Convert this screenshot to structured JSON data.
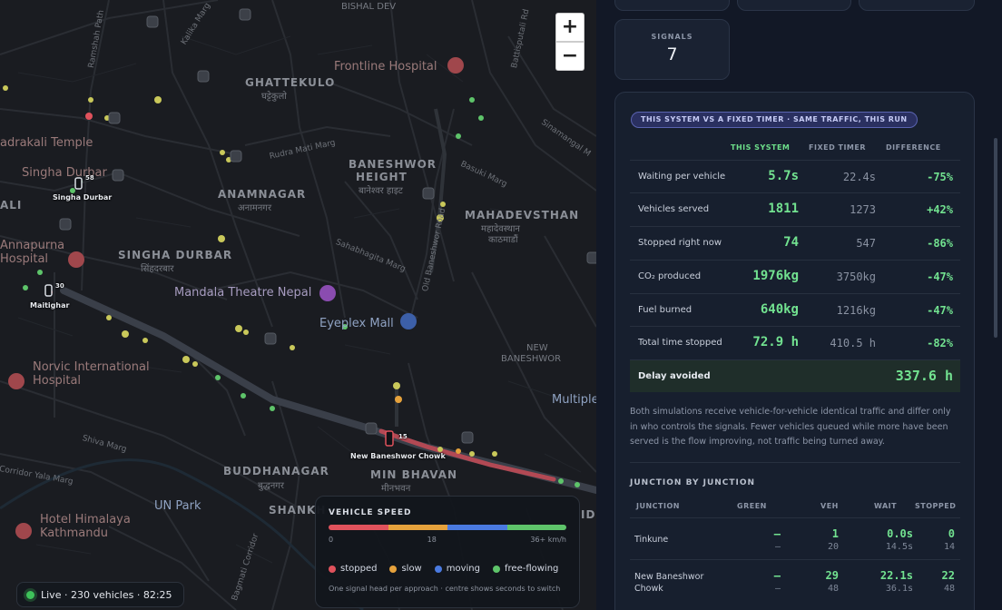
{
  "map": {
    "zoom_in": "+",
    "zoom_out": "−",
    "places": [
      {
        "id": "bishal-dev",
        "text": "BISHAL DEV"
      },
      {
        "id": "ghattekulo",
        "text": "GHATTEKULO"
      },
      {
        "id": "ghattekulo-np",
        "text": "घट्टेकुलो"
      },
      {
        "id": "frontline-hospital",
        "text": "Frontline Hospital"
      },
      {
        "id": "kadrakali-temple",
        "text": "adrakali Temple"
      },
      {
        "id": "singha-durbar-top",
        "text": "Singha Durbar"
      },
      {
        "id": "baneshwor-height",
        "text": "BANESHWOR"
      },
      {
        "id": "baneshwor-height-2",
        "text": "HEIGHT"
      },
      {
        "id": "baneshwor-height-np",
        "text": "बानेश्वर हाइट"
      },
      {
        "id": "anamnagar",
        "text": "ANAMNAGAR"
      },
      {
        "id": "anamnagar-np",
        "text": "अनामनगर"
      },
      {
        "id": "mahadevsthan",
        "text": "MAHADEVSTHAN"
      },
      {
        "id": "mahadevsthan-np",
        "text": "महादेवस्थान"
      },
      {
        "id": "mahadevsthan-np2",
        "text": "काठमाडौं"
      },
      {
        "id": "ali",
        "text": "ALI"
      },
      {
        "id": "annapurna",
        "text": "Annapurna"
      },
      {
        "id": "hospital-left",
        "text": "Hospital"
      },
      {
        "id": "singha-durbar",
        "text": "SINGHA DURBAR"
      },
      {
        "id": "singha-durbar-np",
        "text": "सिंहदरबार"
      },
      {
        "id": "mandala-theatre",
        "text": "Mandala Theatre Nepal"
      },
      {
        "id": "eyeplex-mall",
        "text": "Eyeplex Mall"
      },
      {
        "id": "norvic",
        "text": "Norvic International"
      },
      {
        "id": "norvic-2",
        "text": "Hospital"
      },
      {
        "id": "new-baneshwor",
        "text": "NEW"
      },
      {
        "id": "new-baneshwor-2",
        "text": "BANESHWOR"
      },
      {
        "id": "multiple",
        "text": "Multiple"
      },
      {
        "id": "buddhanagar",
        "text": "BUDDHANAGAR"
      },
      {
        "id": "buddhanagar-np",
        "text": "बुद्धनगर"
      },
      {
        "id": "min-bhavan",
        "text": "MIN BHAVAN"
      },
      {
        "id": "min-bhavan-np",
        "text": "मीनभवन"
      },
      {
        "id": "shankh",
        "text": "SHANKH"
      },
      {
        "id": "un-park",
        "text": "UN Park"
      },
      {
        "id": "hotel-himalaya",
        "text": "Hotel Himalaya"
      },
      {
        "id": "kathmandu",
        "text": "Kathmandu"
      },
      {
        "id": "id-right",
        "text": "ID"
      }
    ],
    "streets": [
      {
        "id": "ramshah",
        "text": "Ramshah Path"
      },
      {
        "id": "kalika",
        "text": "Kalika Marg"
      },
      {
        "id": "bhattibatti",
        "text": "Battisputali Rd"
      },
      {
        "id": "sinamangal",
        "text": "Sinamangal M"
      },
      {
        "id": "rudramati",
        "text": "Rudra Mati Marg"
      },
      {
        "id": "basuki",
        "text": "Basuki Marg"
      },
      {
        "id": "old-baneshwor",
        "text": "Old Baneshwor Road"
      },
      {
        "id": "sahabhagita",
        "text": "Sahabhagita Marg"
      },
      {
        "id": "shiva",
        "text": "Shiva Marg"
      },
      {
        "id": "corridor",
        "text": "Corridor Yala Marg"
      },
      {
        "id": "bagmati",
        "text": "Bagmati Corridor"
      }
    ],
    "signals": [
      {
        "id": "singha-durbar-signal",
        "label": "Singha Durbar",
        "count": "58"
      },
      {
        "id": "maitighar-signal",
        "label": "Maitighar",
        "count": "30"
      },
      {
        "id": "new-baneshwor-signal",
        "label": "New Baneshwor Chowk",
        "count": "15"
      }
    ]
  },
  "live": {
    "text": "Live · 230 vehicles · 82:25"
  },
  "legend": {
    "title": "VEHICLE SPEED",
    "scale_min": "0",
    "scale_mid": "18",
    "scale_max": "36+ km/h",
    "colors": [
      "#e0525c",
      "#e6a23c",
      "#4a7ae0",
      "#5ec46a"
    ],
    "keys": [
      {
        "label": "stopped",
        "color": "#e0525c"
      },
      {
        "label": "slow",
        "color": "#e6a23c"
      },
      {
        "label": "moving",
        "color": "#4a7ae0"
      },
      {
        "label": "free-flowing",
        "color": "#5ec46a"
      }
    ],
    "note": "One signal head per approach · centre shows seconds to switch"
  },
  "stats": {
    "signals_label": "SIGNALS",
    "signals_value": "7"
  },
  "comparison": {
    "badge": "THIS SYSTEM VS A FIXED TIMER · SAME TRAFFIC, THIS RUN",
    "headers": {
      "system": "THIS SYSTEM",
      "fixed": "FIXED TIMER",
      "diff": "DIFFERENCE"
    },
    "rows": [
      {
        "name": "Waiting per vehicle",
        "system": "5.7s",
        "fixed": "22.4s",
        "diff": "-75%"
      },
      {
        "name": "Vehicles served",
        "system": "1811",
        "fixed": "1273",
        "diff": "+42%"
      },
      {
        "name": "Stopped right now",
        "system": "74",
        "fixed": "547",
        "diff": "-86%"
      },
      {
        "name": "CO₂ produced",
        "system": "1976kg",
        "fixed": "3750kg",
        "diff": "-47%"
      },
      {
        "name": "Fuel burned",
        "system": "640kg",
        "fixed": "1216kg",
        "diff": "-47%"
      },
      {
        "name": "Total time stopped",
        "system": "72.9 h",
        "fixed": "410.5 h",
        "diff": "-82%"
      }
    ],
    "delay_label": "Delay avoided",
    "delay_value": "337.6 h",
    "explanation": "Both simulations receive vehicle-for-vehicle identical traffic and differ only in who controls the signals. Fewer vehicles queued while more have been served is the flow improving, not traffic being turned away."
  },
  "junctions": {
    "title": "JUNCTION BY JUNCTION",
    "headers": {
      "junction": "JUNCTION",
      "green": "GREEN",
      "veh": "VEH",
      "wait": "WAIT",
      "stopped": "STOPPED"
    },
    "rows": [
      {
        "name": "Tinkune",
        "green_top": "–",
        "green_bot": "–",
        "veh_top": "1",
        "veh_bot": "20",
        "wait_top": "0.0s",
        "wait_bot": "14.5s",
        "stopped_top": "0",
        "stopped_bot": "14"
      },
      {
        "name": "New Baneshwor Chowk",
        "green_top": "–",
        "green_bot": "–",
        "veh_top": "29",
        "veh_bot": "48",
        "wait_top": "22.1s",
        "wait_bot": "36.1s",
        "stopped_top": "22",
        "stopped_bot": "48"
      }
    ]
  }
}
